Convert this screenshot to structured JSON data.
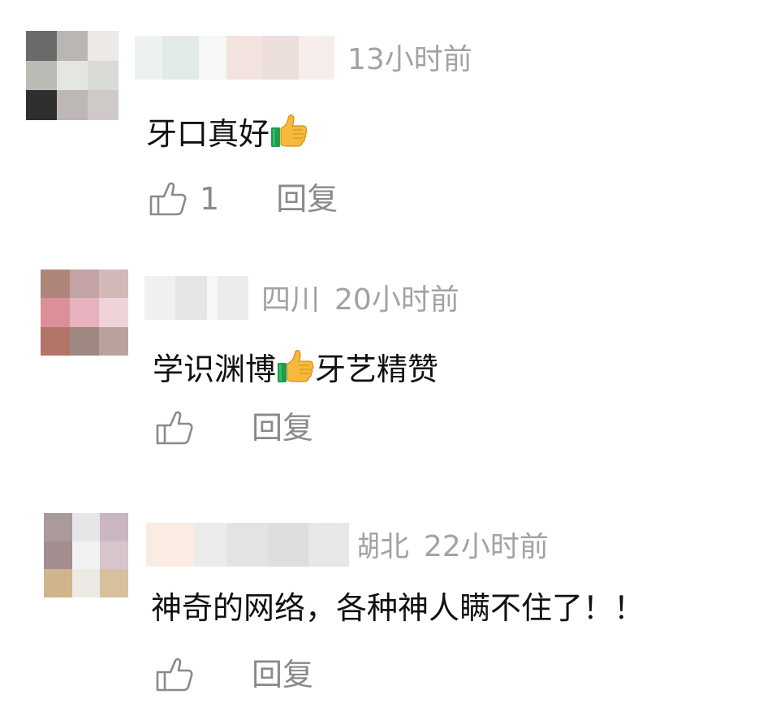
{
  "comments": [
    {
      "time": "13小时前",
      "location": "",
      "text_before": "牙口真好",
      "text_after": "",
      "likes": "1",
      "reply_label": "回复"
    },
    {
      "time": "20小时前",
      "location": "四川",
      "text_before": "学识渊博",
      "text_after": "牙艺精赞",
      "likes": "",
      "reply_label": "回复"
    },
    {
      "time": "22小时前",
      "location": "湖北",
      "text_before": "神奇的网络，各种神人瞒不住了！！",
      "text_after": "",
      "likes": "",
      "reply_label": "回复"
    }
  ],
  "icons": {
    "like": "thumbs-up-outline-icon",
    "emoji": "thumbs-up-emoji-icon"
  },
  "colors": {
    "text_primary": "#111111",
    "text_meta": "#a3a3a3",
    "text_action": "#8a8a8a",
    "background": "#ffffff"
  }
}
